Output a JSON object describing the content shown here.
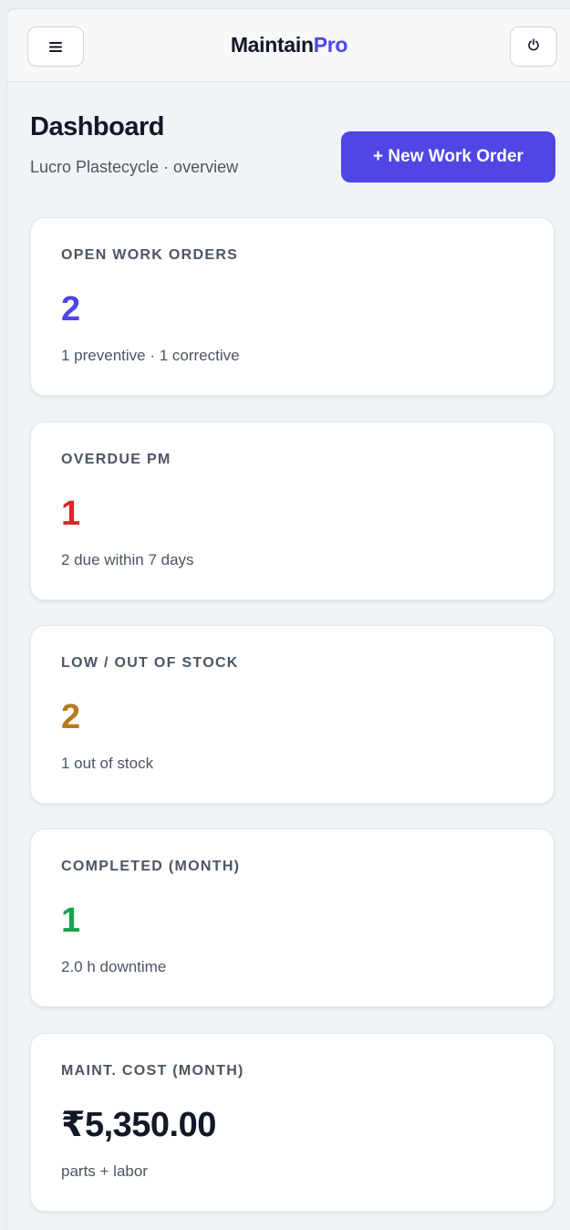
{
  "header": {
    "brand_prefix": "Maintain",
    "brand_suffix": "Pro",
    "menu_icon": "hamburger-menu-icon",
    "power_icon": "power-icon"
  },
  "page": {
    "title": "Dashboard",
    "subtitle": "Lucro Plastecycle · overview",
    "new_work_order_label": "+ New Work Order"
  },
  "colors": {
    "accent": "#4f46e5",
    "danger": "#dc2626",
    "warning": "#b7791f",
    "success": "#16a34a",
    "neutral": "#111827"
  },
  "cards": [
    {
      "label": "OPEN WORK ORDERS",
      "value": "2",
      "note": "1 preventive · 1 corrective",
      "value_color": "#4f46e5"
    },
    {
      "label": "OVERDUE PM",
      "value": "1",
      "note": "2 due within 7 days",
      "value_color": "#dc2626"
    },
    {
      "label": "LOW / OUT OF STOCK",
      "value": "2",
      "note": "1 out of stock",
      "value_color": "#b7791f"
    },
    {
      "label": "COMPLETED (MONTH)",
      "value": "1",
      "note": "2.0 h downtime",
      "value_color": "#16a34a"
    },
    {
      "label": "MAINT. COST (MONTH)",
      "value": "₹5,350.00",
      "note": "parts + labor",
      "value_color": "#111827"
    }
  ]
}
